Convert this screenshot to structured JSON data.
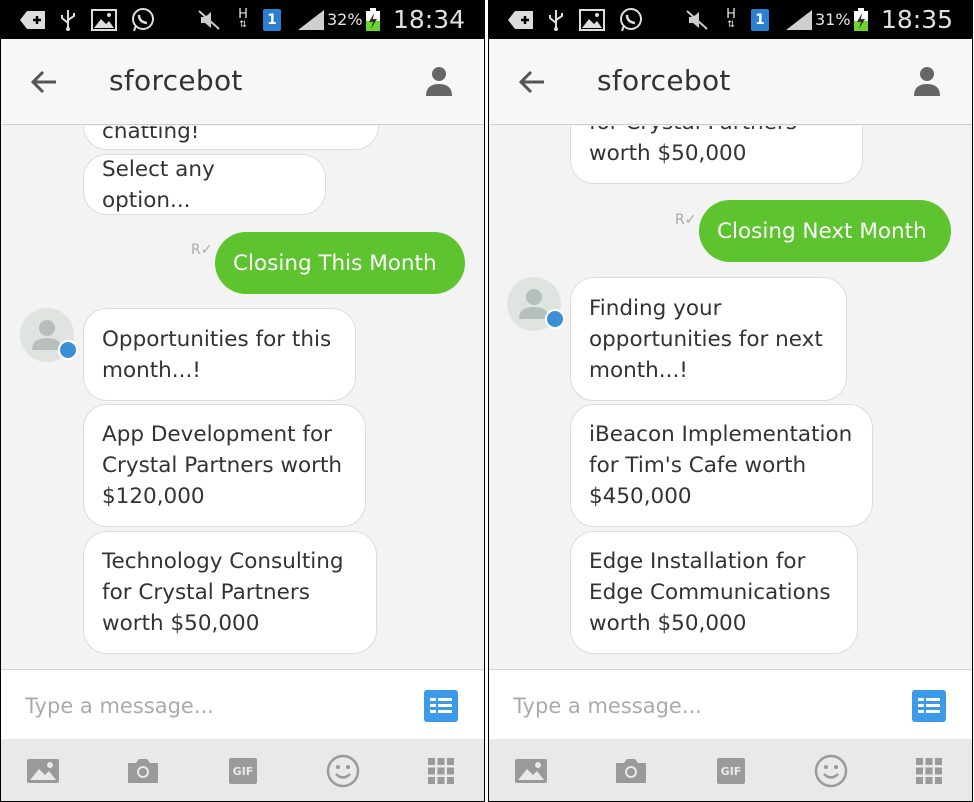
{
  "screens": [
    {
      "status": {
        "battery_pct": "32%",
        "time": "18:34",
        "network": "H",
        "sim": "1"
      },
      "header": {
        "title": "sforcebot"
      },
      "messages": {
        "top_partial": "chatting!",
        "select": "Select any option...",
        "outgoing": "Closing This Month",
        "intro_line1": "Opportunities for this",
        "intro_line2": "month...!",
        "opp1_line1": "App Development for",
        "opp1_line2": "Crystal Partners worth",
        "opp1_line3": "$120,000",
        "opp2_line1": "Technology Consulting",
        "opp2_line2": "for Crystal Partners",
        "opp2_line3": "worth $50,000"
      },
      "input": {
        "placeholder": "Type a message..."
      }
    },
    {
      "status": {
        "battery_pct": "31%",
        "time": "18:35",
        "network": "H",
        "sim": "1"
      },
      "header": {
        "title": "sforcebot"
      },
      "messages": {
        "top_partial_line1": "for Crystal Partners",
        "top_partial_line2": "worth $50,000",
        "outgoing": "Closing Next Month",
        "intro_line1": "Finding your",
        "intro_line2": "opportunities for next",
        "intro_line3": "month...!",
        "opp1_line1": "iBeacon Implementation",
        "opp1_line2": "for Tim's Cafe worth",
        "opp1_line3": "$450,000",
        "opp2_line1": "Edge Installation for",
        "opp2_line2": "Edge Communications",
        "opp2_line3": "worth $50,000"
      },
      "input": {
        "placeholder": "Type a message..."
      }
    }
  ],
  "toolbar": {
    "gif_label": "GIF"
  },
  "icons": [
    "add-icon",
    "usb-icon",
    "image-icon",
    "whatsapp-icon",
    "mute-icon",
    "signal-icon",
    "battery-icon",
    "back-arrow-icon",
    "person-icon",
    "keyboard-icon",
    "gallery-icon",
    "camera-icon",
    "gif-icon",
    "emoji-icon",
    "apps-grid-icon"
  ],
  "colors": {
    "outgoing_bubble": "#5dc32e",
    "keyboard_button": "#3d9ae8",
    "avatar_badge": "#3b8fd6"
  }
}
